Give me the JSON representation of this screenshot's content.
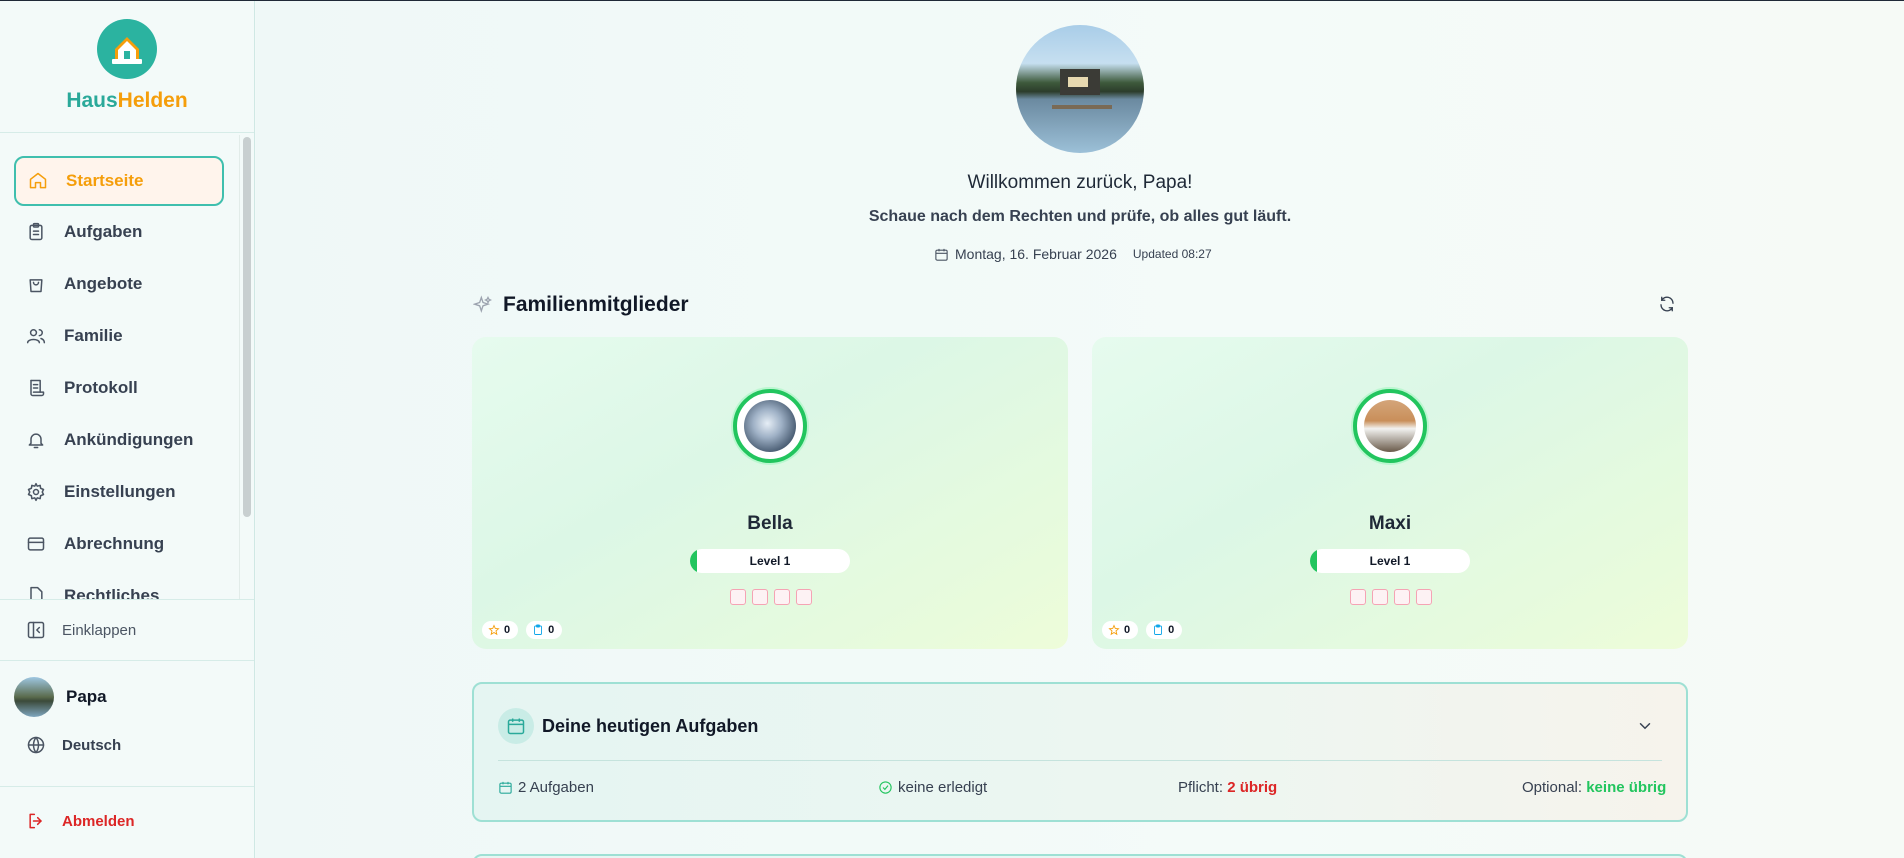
{
  "brand": {
    "part1": "Haus",
    "part2": "Helden",
    "logo_text": "HausHelden"
  },
  "nav": {
    "items": [
      {
        "label": "Startseite",
        "icon": "home-icon",
        "active": true
      },
      {
        "label": "Aufgaben",
        "icon": "clipboard-icon"
      },
      {
        "label": "Angebote",
        "icon": "shopping-bag-icon"
      },
      {
        "label": "Familie",
        "icon": "users-icon"
      },
      {
        "label": "Protokoll",
        "icon": "scroll-icon"
      },
      {
        "label": "Ankündigungen",
        "icon": "bell-icon"
      },
      {
        "label": "Einstellungen",
        "icon": "gear-icon"
      },
      {
        "label": "Abrechnung",
        "icon": "credit-card-icon"
      },
      {
        "label": "Rechtliches",
        "icon": "file-icon"
      }
    ],
    "collapse_label": "Einklappen"
  },
  "user": {
    "name": "Papa",
    "language": "Deutsch",
    "logout_label": "Abmelden"
  },
  "hero": {
    "welcome": "Willkommen zurück, Papa!",
    "subtitle": "Schaue nach dem Rechten und prüfe, ob alles gut läuft.",
    "date": "Montag, 16. Februar 2026",
    "updated": "Updated 08:27"
  },
  "family": {
    "title": "Familienmitglieder",
    "members": [
      {
        "name": "Bella",
        "level": "Level 1",
        "stars": "0",
        "tasks": "0"
      },
      {
        "name": "Maxi",
        "level": "Level 1",
        "stars": "0",
        "tasks": "0"
      }
    ]
  },
  "today": {
    "title": "Deine heutigen Aufgaben",
    "count": "2 Aufgaben",
    "done": "keine erledigt",
    "required_label": "Pflicht:",
    "required_value": "2 übrig",
    "optional_label": "Optional:",
    "optional_value": "keine übrig"
  },
  "colors": {
    "accent": "#2aa99a",
    "brand_orange": "#f59e0b",
    "danger": "#dc2626",
    "success": "#22c55e"
  }
}
